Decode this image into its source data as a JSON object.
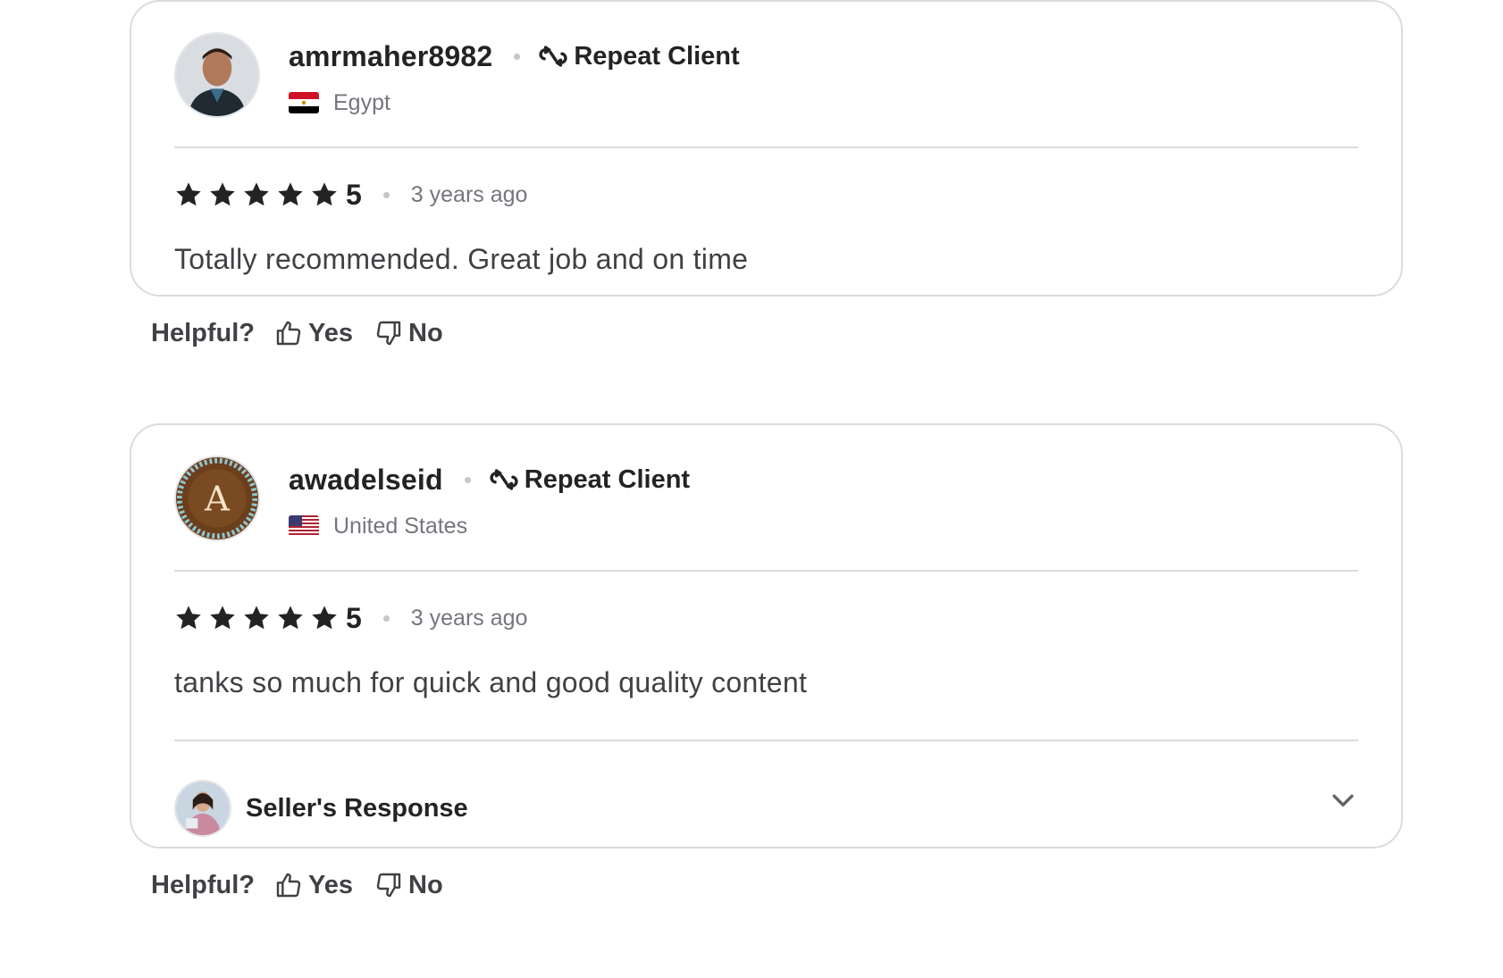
{
  "reviews": [
    {
      "username": "amrmaher8982",
      "badge": "Repeat Client",
      "country": "Egypt",
      "rating": "5",
      "time": "3 years ago",
      "text": "Totally recommended. Great job and on time",
      "avatar_icon": "user-photo-avatar",
      "flag_icon": "egypt-flag-icon",
      "helpful": {
        "label": "Helpful?",
        "yes": "Yes",
        "no": "No"
      }
    },
    {
      "username": "awadelseid",
      "badge": "Repeat Client",
      "country": "United States",
      "rating": "5",
      "time": "3 years ago",
      "text": "tanks so much for quick and good quality content",
      "avatar_icon": "letter-a-avatar",
      "avatar_letter": "A",
      "flag_icon": "us-flag-icon",
      "seller_response_label": "Seller's Response",
      "helpful": {
        "label": "Helpful?",
        "yes": "Yes",
        "no": "No"
      }
    }
  ],
  "colors": {
    "text_primary": "#222325",
    "text_secondary": "#74767e",
    "border": "#dadbdd",
    "star": "#222325"
  }
}
